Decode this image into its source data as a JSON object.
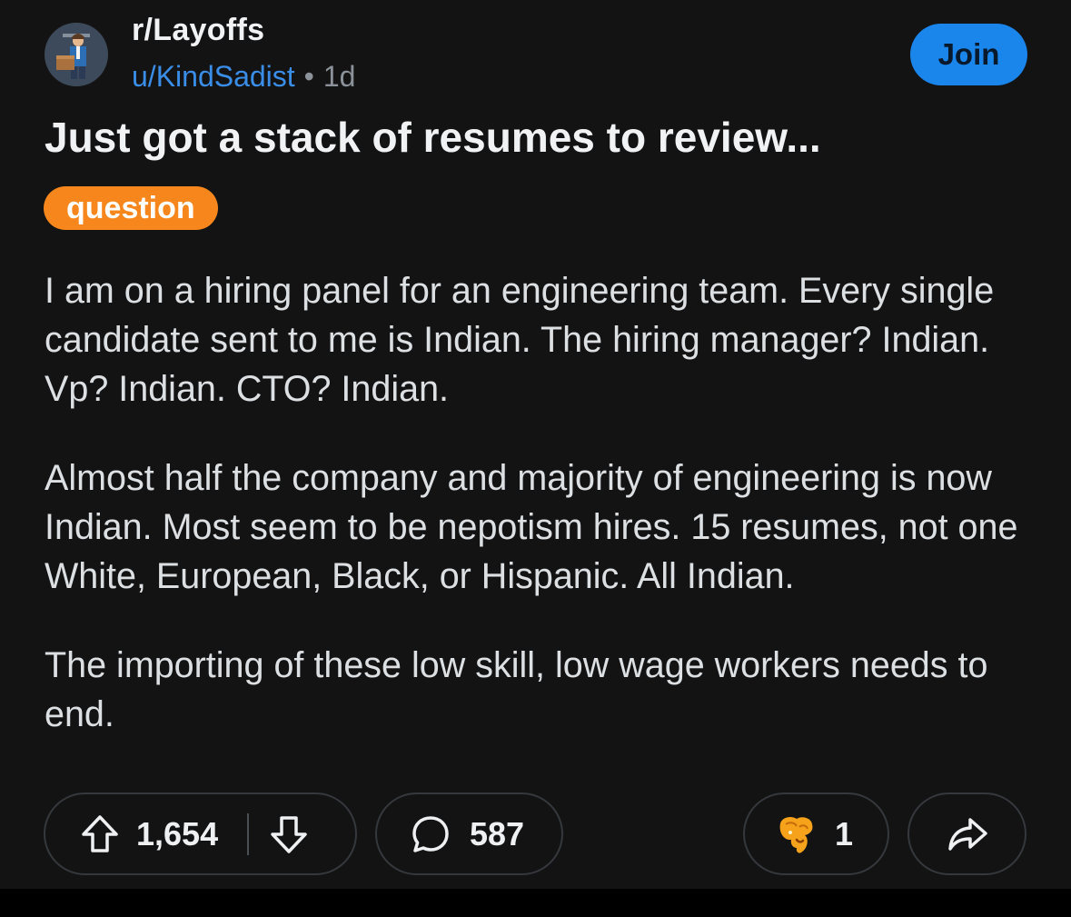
{
  "post": {
    "community": "r/Layoffs",
    "username": "u/KindSadist",
    "separator": "•",
    "age": "1d",
    "join_label": "Join",
    "title": "Just got a stack of resumes to review...",
    "flair": "question",
    "paragraphs": [
      "I am on a hiring panel for an engineering team. Every single candidate sent to me is Indian. The hiring manager? Indian. Vp? Indian. CTO? Indian.",
      "Almost half the company and majority of engineering is now Indian. Most seem to be nepotism hires. 15 resumes, not one White, European, Black, or Hispanic. All Indian.",
      "The importing of these low skill, low wage workers needs to end."
    ]
  },
  "actions": {
    "upvotes": "1,654",
    "comments": "587",
    "awards": "1"
  },
  "icons": {
    "avatar": "community-avatar",
    "upvote": "upvote-arrow-icon",
    "downvote": "downvote-arrow-icon",
    "comment": "comment-bubble-icon",
    "award": "award-emoji-icon",
    "share": "share-arrow-icon"
  },
  "colors": {
    "background": "#131314",
    "join_button": "#1a85ea",
    "flair": "#f7871c",
    "username": "#3a8ee8",
    "meta": "#8b9299"
  }
}
